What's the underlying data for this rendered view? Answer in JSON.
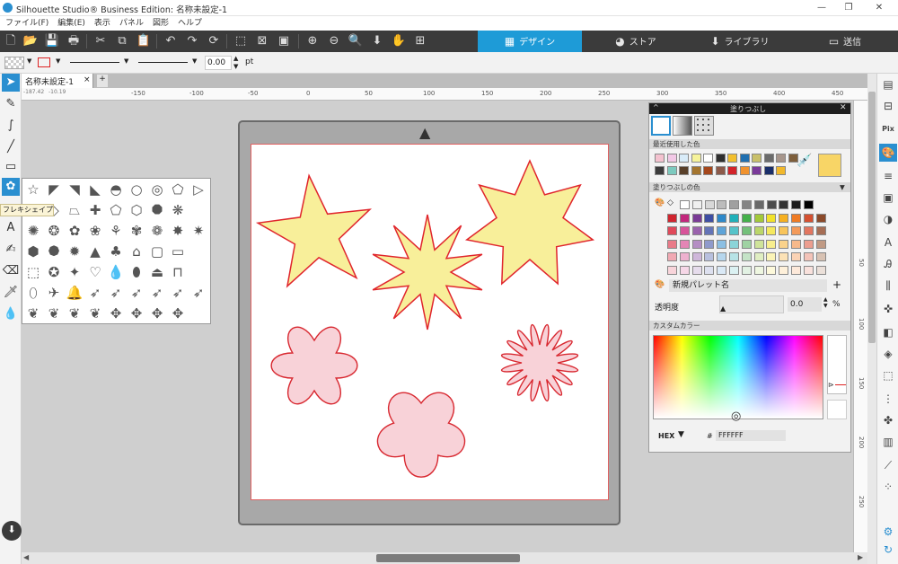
{
  "window": {
    "title": "Silhouette Studio® Business Edition: 名称未設定-1"
  },
  "menu": [
    "ファイル(F)",
    "編集(E)",
    "表示",
    "パネル",
    "図形",
    "ヘルプ"
  ],
  "nav_tabs": [
    {
      "label": "デザイン",
      "icon": "grid-icon",
      "active": true
    },
    {
      "label": "ストア",
      "icon": "store-icon",
      "active": false
    },
    {
      "label": "ライブラリ",
      "icon": "library-icon",
      "active": false
    },
    {
      "label": "送信",
      "icon": "send-icon",
      "active": false
    }
  ],
  "props": {
    "line_width": "0.00",
    "unit": "pt"
  },
  "doc_tab": {
    "name": "名称未設定-1",
    "close": "×",
    "add": "+"
  },
  "coords": {
    "x": "-187.42",
    "y": "-10.19"
  },
  "ruler_h": [
    "-150",
    "-100",
    "-50",
    "0",
    "50",
    "100",
    "150",
    "200",
    "250",
    "300",
    "350",
    "400",
    "450"
  ],
  "ruler_v": [
    "50",
    "100",
    "150",
    "200",
    "250"
  ],
  "tooltip": "フレキシェイプ",
  "fill_panel": {
    "title": "塗りつぶし",
    "recent_label": "最近使用した色",
    "fill_label": "塗りつぶしの色",
    "palette_name": "新規パレット名",
    "transparency_label": "透明度",
    "transparency_value": "0.0",
    "percent": "%",
    "custom_label": "カスタムカラー",
    "hex_label": "HEX",
    "hash": "#",
    "hex_value": "FFFFFF",
    "current_color": "#f8d566",
    "recent_colors": [
      "#f4c2cf",
      "#f2c8e6",
      "#d9ecf9",
      "#f6f39a",
      "#ffffff",
      "#2e2e2e",
      "#f2bf2e",
      "#1f6fb0",
      "#c9c06a",
      "#6b6b6b",
      "#a7968c",
      "#7d5e3b",
      "#3b3b3b",
      "#7dcabf",
      "#59402a",
      "#a4752e",
      "#a5471c",
      "#8c5a4a",
      "#d2232a",
      "#f0922e",
      "#7a3a9a",
      "#1a2f6a",
      "#f1b82c"
    ],
    "colors": [
      [
        "#ffffff",
        "#f0f0f0",
        "#d8d8d8",
        "#bcbcbc",
        "#a0a0a0",
        "#858585",
        "#696969",
        "#4d4d4d",
        "#333333",
        "#1c1c1c",
        "#000000"
      ],
      [
        "#d0252f",
        "#c2277c",
        "#7a3b96",
        "#3e4ea3",
        "#2d88c9",
        "#20b0b9",
        "#44b04a",
        "#a3c93a",
        "#f2e22b",
        "#f6b021",
        "#ef7b24",
        "#d45030",
        "#8b4a2a"
      ],
      [
        "#e0495a",
        "#d8549a",
        "#9a62ad",
        "#6474b7",
        "#5fa4d8",
        "#56c3c9",
        "#74c07a",
        "#bbd66a",
        "#f5e85e",
        "#f8c45a",
        "#f39a5a",
        "#e27660",
        "#a66e55"
      ],
      [
        "#e97a88",
        "#e485b5",
        "#b58ec4",
        "#8f9acb",
        "#8cbfe3",
        "#8ad4d8",
        "#9fd2a3",
        "#cfe39a",
        "#f8ee8e",
        "#fad28b",
        "#f7b98b",
        "#ec9e8f",
        "#c09a84"
      ],
      [
        "#f1a9b3",
        "#eeb1cf",
        "#cfb7da",
        "#b8c0de",
        "#b6d6ed",
        "#b7e3e6",
        "#c4e3c7",
        "#e0eec2",
        "#fbf4b7",
        "#fce2b6",
        "#fbd3b5",
        "#f3c3b8",
        "#d8c2b3"
      ],
      [
        "#f8d4da",
        "#f6d7e7",
        "#e6dcec",
        "#dde0ef",
        "#dae9f6",
        "#dbf1f2",
        "#e2f1e3",
        "#eff7e1",
        "#fdf9db",
        "#fef0da",
        "#fde9da",
        "#f9e1dc",
        "#ebe0d9"
      ]
    ]
  },
  "canvas": {
    "stars": [
      "#f8ef9a",
      "#e0252c"
    ],
    "flowers": [
      "#f8d2d8",
      "#d82830"
    ]
  }
}
